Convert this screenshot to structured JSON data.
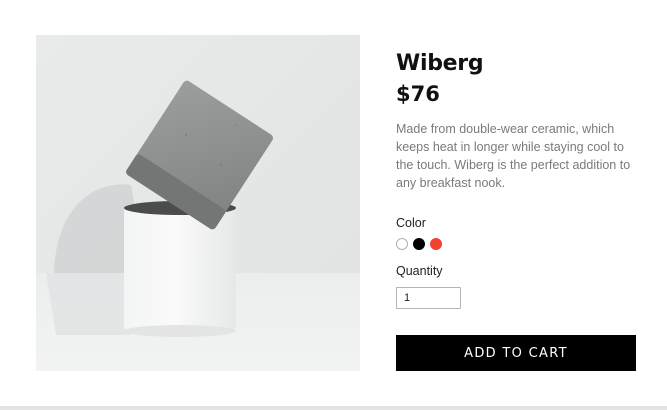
{
  "product": {
    "title": "Wiberg",
    "price": "$76",
    "description": "Made from double-wear ceramic, which keeps heat in longer while staying cool to the touch. Wiberg is the perfect addition to any breakfast nook.",
    "image_name": "stacked-concrete-and-white-ceramic-pots"
  },
  "color": {
    "label": "Color",
    "options": [
      {
        "name": "white",
        "hex": "#ffffff",
        "border": "#b0b0b0"
      },
      {
        "name": "black",
        "hex": "#000000",
        "border": "#000000"
      },
      {
        "name": "red",
        "hex": "#f24332",
        "border": "#f24332"
      }
    ]
  },
  "quantity": {
    "label": "Quantity",
    "value": "1"
  },
  "cart": {
    "button_label": "ADD TO CART"
  },
  "colors": {
    "button_bg": "#000000",
    "button_text": "#ffffff",
    "description_text": "#7a7a7a"
  }
}
